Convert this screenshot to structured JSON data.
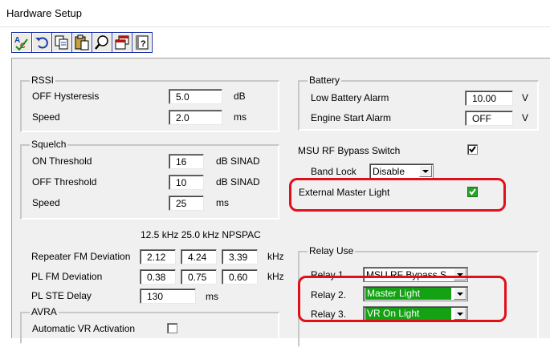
{
  "window": {
    "title": "Hardware Setup"
  },
  "toolbar": {
    "buttons": [
      {
        "icon": "spell-check-icon"
      },
      {
        "icon": "undo-icon"
      },
      {
        "icon": "copy-icon"
      },
      {
        "icon": "paste-icon"
      },
      {
        "icon": "find-icon"
      },
      {
        "icon": "window-icon"
      },
      {
        "icon": "help-icon"
      }
    ]
  },
  "rssi": {
    "title": "RSSI",
    "off_hysteresis": {
      "label": "OFF Hysteresis",
      "value": "5.0",
      "unit": "dB"
    },
    "speed": {
      "label": "Speed",
      "value": "2.0",
      "unit": "ms"
    }
  },
  "squelch": {
    "title": "Squelch",
    "on_threshold": {
      "label": "ON Threshold",
      "value": "16",
      "unit": "dB SINAD"
    },
    "off_threshold": {
      "label": "OFF Threshold",
      "value": "10",
      "unit": "dB SINAD"
    },
    "speed": {
      "label": "Speed",
      "value": "25",
      "unit": "ms"
    }
  },
  "deviation": {
    "col_headers": "12.5 kHz 25.0 kHz  NPSPAC",
    "repeater_fm": {
      "label": "Repeater FM Deviation",
      "values": [
        "2.12",
        "4.24",
        "3.39"
      ],
      "unit": "kHz"
    },
    "pl_fm": {
      "label": "PL FM Deviation",
      "values": [
        "0.38",
        "0.75",
        "0.60"
      ],
      "unit": "kHz"
    },
    "pl_ste": {
      "label": "PL STE Delay",
      "value": "130",
      "unit": "ms"
    }
  },
  "avra": {
    "title": "AVRA",
    "auto_vr": {
      "label": "Automatic VR Activation",
      "checked": false
    }
  },
  "battery": {
    "title": "Battery",
    "low_alarm": {
      "label": "Low Battery Alarm",
      "value": "10.00",
      "unit": "V"
    },
    "engine_start": {
      "label": "Engine Start Alarm",
      "value": "OFF",
      "unit": "V"
    }
  },
  "msu": {
    "bypass_label": "MSU RF Bypass Switch",
    "bypass_checked": true,
    "band_lock_label": "Band Lock",
    "band_lock_value": "Disable",
    "external_master_label": "External Master Light",
    "external_master_checked": true
  },
  "relay_use": {
    "title": "Relay Use",
    "relays": [
      {
        "label": "Relay 1.",
        "value": "MSU RF Bypass S",
        "highlighted": false
      },
      {
        "label": "Relay 2.",
        "value": "Master Light",
        "highlighted": true
      },
      {
        "label": "Relay 3.",
        "value": "VR On Light",
        "highlighted": true
      }
    ]
  },
  "colors": {
    "highlight_box": "#e0101a",
    "relay_highlight": "#14a214",
    "toolbar_border": "#1830a8"
  }
}
